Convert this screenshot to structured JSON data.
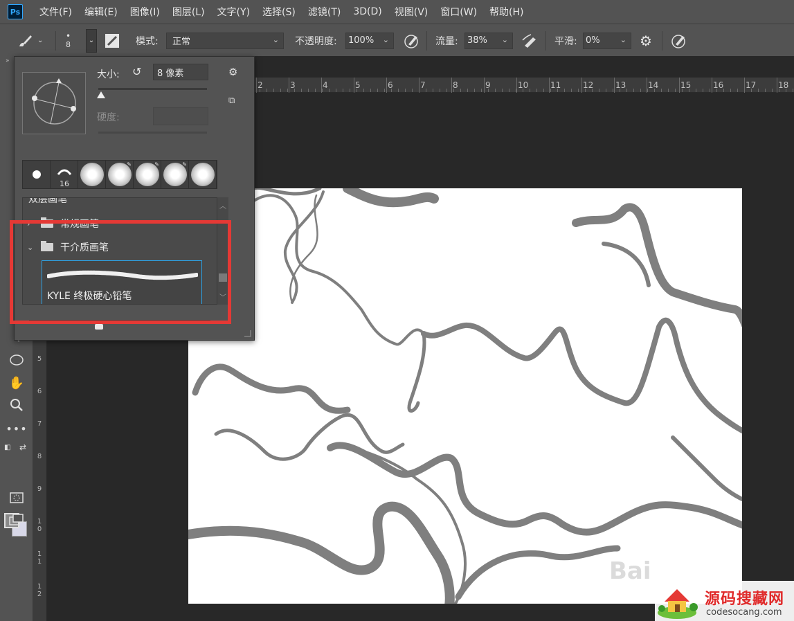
{
  "app": {
    "logo": "Ps"
  },
  "menu": [
    "文件(F)",
    "编辑(E)",
    "图像(I)",
    "图层(L)",
    "文字(Y)",
    "选择(S)",
    "滤镜(T)",
    "3D(D)",
    "视图(V)",
    "窗口(W)",
    "帮助(H)"
  ],
  "options": {
    "brush_size": "8",
    "mode_label": "模式:",
    "mode_value": "正常",
    "opacity_label": "不透明度:",
    "opacity_value": "100%",
    "flow_label": "流量:",
    "flow_value": "38%",
    "smooth_label": "平滑:",
    "smooth_value": "0%"
  },
  "brush_popup": {
    "size_label": "大小:",
    "size_value": "8 像素",
    "hardness_label": "硬度:",
    "tips": [
      {
        "kind": "hard-dot",
        "num": ""
      },
      {
        "kind": "custom",
        "num": "16"
      },
      {
        "kind": "soft",
        "num": ""
      },
      {
        "kind": "soft",
        "num": ""
      },
      {
        "kind": "soft",
        "num": ""
      },
      {
        "kind": "soft",
        "num": ""
      },
      {
        "kind": "soft",
        "num": ""
      }
    ],
    "list": {
      "group_top": "双层画笔",
      "group_general": "常规画笔",
      "group_dry": "干介质画笔",
      "selected_preset": "KYLE 终极硬心铅笔"
    }
  },
  "ruler": {
    "h_ticks": [
      "2",
      "3",
      "4",
      "5",
      "6",
      "7",
      "8",
      "9",
      "10",
      "11",
      "12",
      "13",
      "14",
      "15",
      "16",
      "17",
      "18"
    ],
    "v_ticks": [
      "5",
      "6",
      "7",
      "8",
      "9",
      "1 0",
      "1 1",
      "1 2"
    ]
  },
  "watermarks": {
    "baidu": "Bai",
    "site_title": "源码搜藏网",
    "site_url": "codesocang.com"
  },
  "colors": {
    "ui_panel": "#535353",
    "workspace": "#282828",
    "highlight": "#e53935",
    "selection": "#2ea3e6",
    "stroke": "#808080"
  }
}
